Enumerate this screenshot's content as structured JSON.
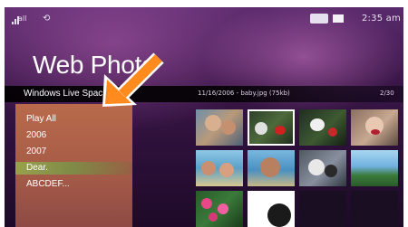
{
  "status": {
    "signal_label": "all",
    "clock": "2:35 am"
  },
  "page": {
    "title": "Web Photo"
  },
  "infobar": {
    "breadcrumb": "Windows Live Spac",
    "file_info": "11/16/2006 - baby.jpg (75kb)",
    "counter": "2/30"
  },
  "menu": {
    "items": [
      {
        "label": "Play All"
      },
      {
        "label": "2006"
      },
      {
        "label": "2007"
      },
      {
        "label": "Dear."
      },
      {
        "label": "ABCDEF..."
      }
    ],
    "selected_index": 3
  },
  "colors": {
    "menu_bg": "#a45a47",
    "selection": "#98a24c",
    "highlight_arrow": "#ff8a1e",
    "thumb_border_selected": "#ffffff"
  },
  "grid": {
    "selected_index": 1,
    "thumbnails": [
      {
        "name": "thumbnail-photo-1"
      },
      {
        "name": "thumbnail-photo-2"
      },
      {
        "name": "thumbnail-photo-3"
      },
      {
        "name": "thumbnail-photo-4"
      },
      {
        "name": "thumbnail-photo-5"
      },
      {
        "name": "thumbnail-photo-6"
      },
      {
        "name": "thumbnail-photo-7"
      },
      {
        "name": "thumbnail-photo-8"
      },
      {
        "name": "thumbnail-photo-9"
      },
      {
        "name": "thumbnail-photo-10"
      },
      {
        "name": "thumbnail-empty-1"
      },
      {
        "name": "thumbnail-empty-2"
      }
    ]
  },
  "icons": {
    "signal": "signal-strength-icon",
    "sync": "sync-icon",
    "tray": "connection-icon",
    "battery": "battery-icon",
    "annotation": "orange-arrow-icon"
  }
}
